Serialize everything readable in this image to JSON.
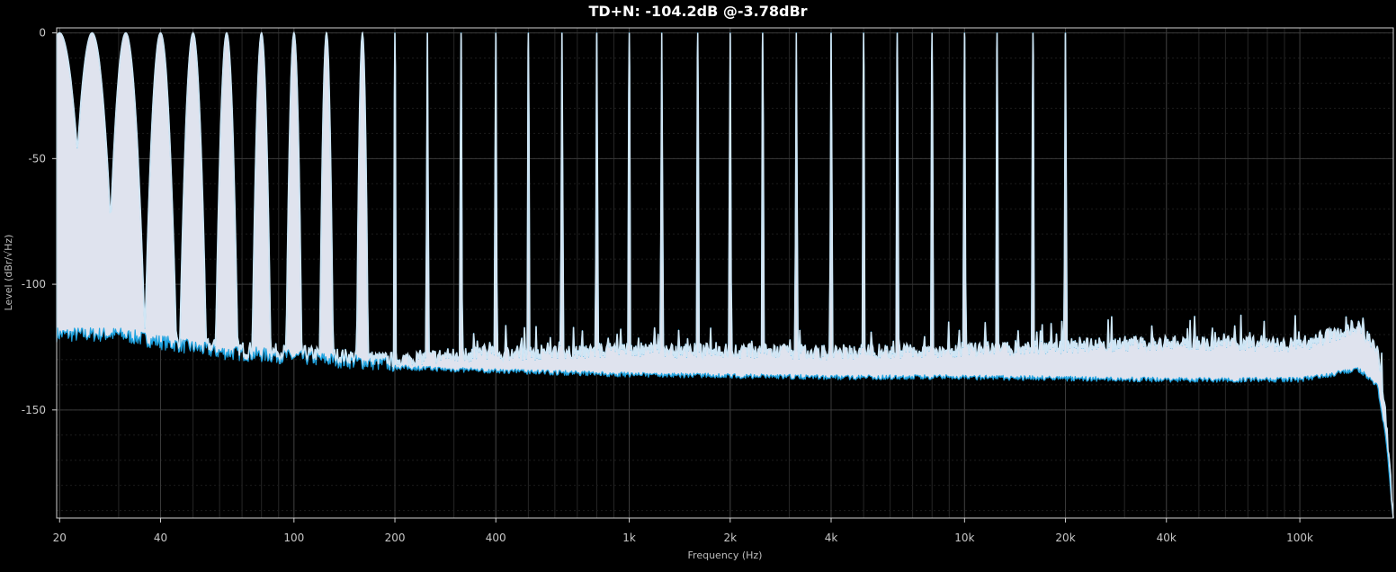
{
  "chart_data": {
    "type": "line",
    "title": "TD+N: -104.2dB @-3.78dBr",
    "xlabel": "Frequency (Hz)",
    "ylabel": "Level (dBr/√Hz)",
    "x_scale": "log",
    "xlim": [
      19.6,
      190000
    ],
    "ylim": [
      -193,
      2
    ],
    "x_ticks": [
      {
        "value": 20,
        "label": "20"
      },
      {
        "value": 40,
        "label": "40"
      },
      {
        "value": 100,
        "label": "100"
      },
      {
        "value": 200,
        "label": "200"
      },
      {
        "value": 400,
        "label": "400"
      },
      {
        "value": 1000,
        "label": "1k"
      },
      {
        "value": 2000,
        "label": "2k"
      },
      {
        "value": 4000,
        "label": "4k"
      },
      {
        "value": 10000,
        "label": "10k"
      },
      {
        "value": 20000,
        "label": "20k"
      },
      {
        "value": 40000,
        "label": "40k"
      },
      {
        "value": 100000,
        "label": "100k"
      }
    ],
    "y_ticks": [
      {
        "value": 0,
        "label": "0"
      },
      {
        "value": -50,
        "label": "-50"
      },
      {
        "value": -100,
        "label": "-100"
      },
      {
        "value": -150,
        "label": "-150"
      }
    ],
    "grid": true,
    "colors": {
      "background": "#000000",
      "grid": "#3a3a3a",
      "frame": "#d0d0d0",
      "trace_fill": "#dfe3ee",
      "trace_edge": "#1fa3e0"
    },
    "series": [
      {
        "tone_frequencies_hz": [
          20,
          25,
          31.5,
          40,
          50,
          63,
          80,
          100,
          125,
          160,
          200,
          250,
          315,
          400,
          500,
          630,
          800,
          1000,
          1250,
          1600,
          2000,
          2500,
          3150,
          4000,
          5000,
          6300,
          8000,
          10000,
          12500,
          16000,
          20000
        ],
        "tone_level_db": 0,
        "noise_floor_upper": [
          [
            22,
            -118
          ],
          [
            30,
            -118
          ],
          [
            40,
            -121
          ],
          [
            60,
            -125
          ],
          [
            100,
            -127
          ],
          [
            200,
            -130
          ],
          [
            300,
            -128
          ],
          [
            1000,
            -126
          ],
          [
            4000,
            -127
          ],
          [
            10000,
            -126
          ],
          [
            40000,
            -123
          ],
          [
            100000,
            -124
          ],
          [
            150000,
            -117
          ],
          [
            170000,
            -125
          ],
          [
            180000,
            -150
          ],
          [
            190000,
            -193
          ]
        ],
        "noise_floor_lower": [
          [
            200,
            -133
          ],
          [
            300,
            -134
          ],
          [
            1000,
            -136
          ],
          [
            4000,
            -137
          ],
          [
            10000,
            -137
          ],
          [
            40000,
            -138
          ],
          [
            100000,
            -138
          ],
          [
            150000,
            -134
          ],
          [
            170000,
            -140
          ],
          [
            180000,
            -160
          ],
          [
            190000,
            -193
          ]
        ]
      }
    ]
  }
}
